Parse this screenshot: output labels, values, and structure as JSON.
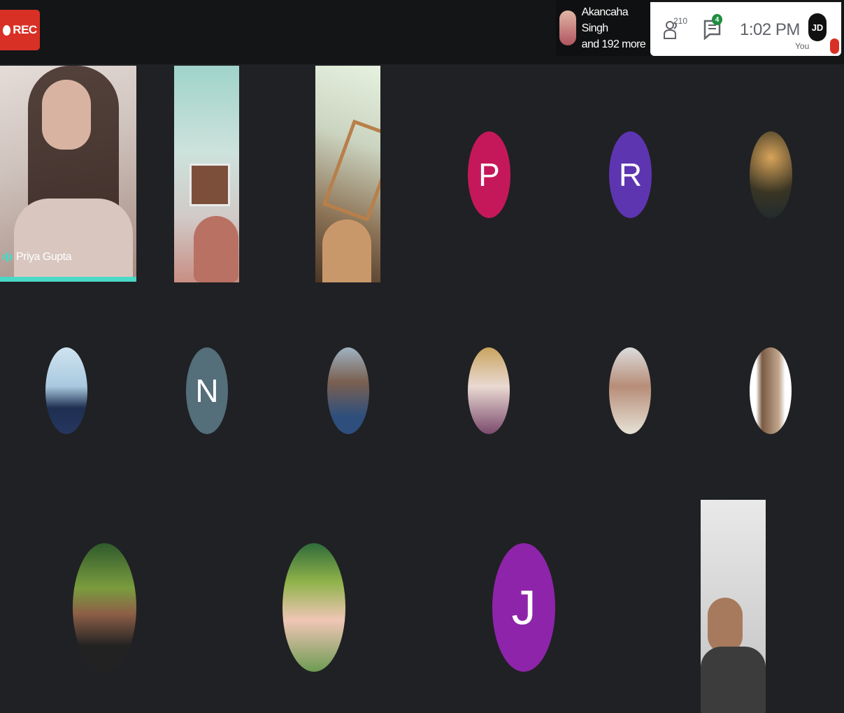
{
  "topbar": {
    "rec_label": "REC",
    "presenter": {
      "line1": "Akancaha Singh",
      "line2": "and 192 more"
    },
    "people_count": "210",
    "chat_unread": "4",
    "time": "1:02 PM",
    "self": {
      "initials": "JD",
      "label": "You"
    }
  },
  "tiles": [
    {
      "name": "Priya Gupta",
      "speaking": true
    }
  ],
  "avatars": [
    {
      "letter": "P",
      "color": "#c5185a"
    },
    {
      "letter": "R",
      "color": "#5e35b1"
    },
    {
      "letter": "N",
      "color": "#546e7a"
    },
    {
      "letter": "J",
      "color": "#8e24aa"
    }
  ],
  "colors": {
    "rec": "#d93025",
    "speaking": "#4ad8c7",
    "background": "#202124"
  }
}
